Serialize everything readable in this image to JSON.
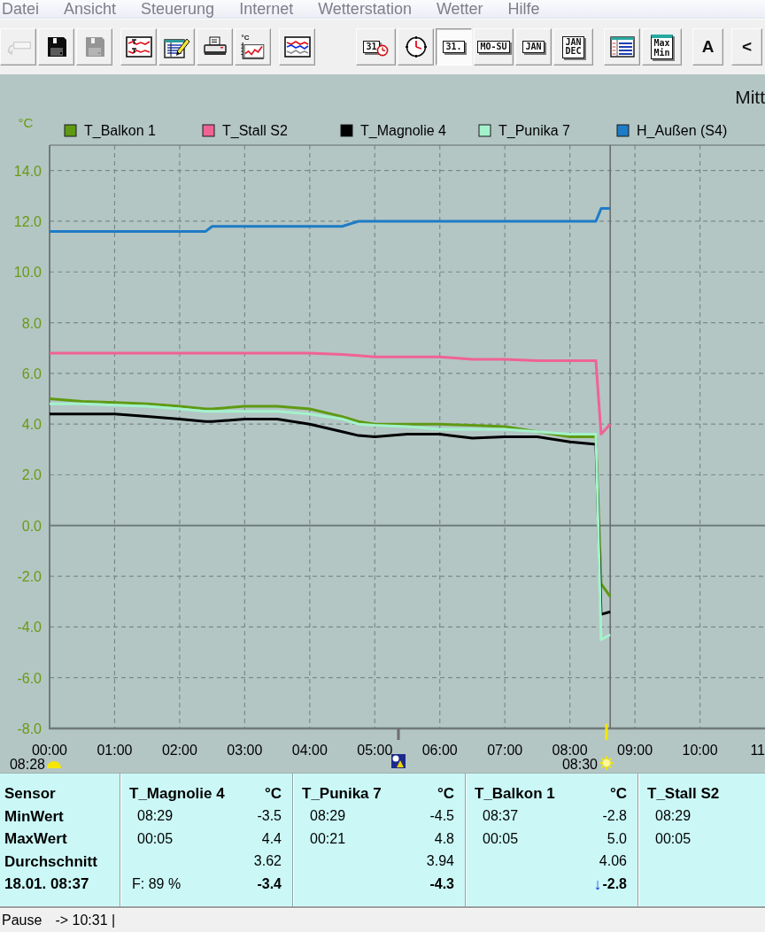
{
  "menu": [
    "Datei",
    "Ansicht",
    "Steuerung",
    "Internet",
    "Wetterstation",
    "Wetter",
    "Hilfe"
  ],
  "toolbar": {
    "groups": [
      {
        "buttons": [
          {
            "kind": "back",
            "disabled": true,
            "selected": false
          },
          {
            "kind": "save",
            "disabled": false,
            "selected": false
          },
          {
            "kind": "save",
            "disabled": true,
            "selected": false
          }
        ]
      },
      {
        "buttons": [
          {
            "kind": "minmax_chart",
            "disabled": false,
            "selected": false
          },
          {
            "kind": "edit_table",
            "disabled": false,
            "selected": false
          },
          {
            "kind": "print",
            "disabled": false,
            "selected": false
          },
          {
            "kind": "temp_chart",
            "label": "°C",
            "disabled": false,
            "selected": false
          }
        ]
      },
      {
        "buttons": [
          {
            "kind": "multi_chart",
            "disabled": false,
            "selected": false
          }
        ]
      },
      {
        "buttons": [
          {
            "kind": "calendar_clock",
            "label": "31",
            "disabled": false,
            "selected": false
          },
          {
            "kind": "clock",
            "disabled": false,
            "selected": false
          },
          {
            "kind": "text_box",
            "label": "31.",
            "disabled": false,
            "selected": true
          },
          {
            "kind": "text_box",
            "label": "MO-SU",
            "disabled": false,
            "selected": false
          },
          {
            "kind": "text_box",
            "label": "JAN",
            "disabled": false,
            "selected": false
          },
          {
            "kind": "text_box",
            "lines": [
              "JAN",
              "DEC"
            ],
            "disabled": false,
            "selected": false
          }
        ]
      },
      {
        "buttons": [
          {
            "kind": "table_view",
            "disabled": false,
            "selected": false
          },
          {
            "kind": "maxmin",
            "lines": [
              "Max",
              "Min"
            ],
            "disabled": false,
            "selected": false
          }
        ]
      },
      {
        "buttons": [
          {
            "kind": "char",
            "label": "A",
            "disabled": false,
            "selected": false
          }
        ]
      },
      {
        "buttons": [
          {
            "kind": "char",
            "label": "<",
            "disabled": false,
            "selected": false
          }
        ]
      }
    ]
  },
  "chart": {
    "markers": [
      {
        "kind": "sunrise",
        "label": "08:28"
      },
      {
        "kind": "moon"
      },
      {
        "kind": "sun",
        "label": "08:30"
      }
    ],
    "chart_data": {
      "type": "line",
      "title": "Mitt",
      "ylabel": "°C",
      "legend": true,
      "grid": true,
      "x": [
        0,
        0.5,
        1,
        1.5,
        2,
        2.4,
        2.5,
        3,
        3.5,
        4,
        4.5,
        4.75,
        5,
        5.5,
        6,
        6.5,
        7,
        7.5,
        8,
        8.4,
        8.48,
        8.62
      ],
      "series": [
        {
          "name": "T_Balkon 1",
          "color": "#5f9a12",
          "values": [
            5.0,
            4.9,
            4.85,
            4.8,
            4.7,
            4.6,
            4.6,
            4.7,
            4.7,
            4.6,
            4.3,
            4.1,
            4.0,
            4.0,
            4.0,
            3.95,
            3.9,
            3.7,
            3.5,
            3.5,
            -2.3,
            -2.8
          ]
        },
        {
          "name": "T_Stall S2",
          "color": "#f06292",
          "values": [
            6.8,
            6.8,
            6.8,
            6.8,
            6.8,
            6.8,
            6.8,
            6.8,
            6.8,
            6.8,
            6.75,
            6.7,
            6.65,
            6.65,
            6.65,
            6.55,
            6.55,
            6.5,
            6.5,
            6.5,
            3.6,
            4.0
          ]
        },
        {
          "name": "T_Magnolie 4",
          "color": "#000000",
          "values": [
            4.4,
            4.4,
            4.4,
            4.3,
            4.2,
            4.1,
            4.1,
            4.2,
            4.2,
            4.0,
            3.7,
            3.55,
            3.5,
            3.6,
            3.6,
            3.45,
            3.5,
            3.5,
            3.3,
            3.2,
            -3.5,
            -3.4
          ]
        },
        {
          "name": "T_Punika 7",
          "color": "#a4f2cc",
          "values": [
            4.8,
            4.8,
            4.75,
            4.7,
            4.6,
            4.5,
            4.5,
            4.5,
            4.5,
            4.4,
            4.2,
            4.0,
            3.95,
            3.9,
            3.8,
            3.8,
            3.8,
            3.7,
            3.6,
            3.6,
            -4.5,
            -4.3
          ]
        },
        {
          "name": "H_Außen (S4)",
          "color": "#1e7bc6",
          "values": [
            11.6,
            11.6,
            11.6,
            11.6,
            11.6,
            11.6,
            11.8,
            11.8,
            11.8,
            11.8,
            11.8,
            12.0,
            12.0,
            12.0,
            12.0,
            12.0,
            12.0,
            12.0,
            12.0,
            12.0,
            12.5,
            12.5
          ]
        }
      ],
      "xlim": [
        0,
        11
      ],
      "ylim": [
        -8,
        15
      ],
      "xticks": [
        {
          "value": 0,
          "label": "00:00"
        },
        {
          "value": 1,
          "label": "01:00"
        },
        {
          "value": 2,
          "label": "02:00"
        },
        {
          "value": 3,
          "label": "03:00"
        },
        {
          "value": 4,
          "label": "04:00"
        },
        {
          "value": 5,
          "label": "05:00"
        },
        {
          "value": 6,
          "label": "06:00"
        },
        {
          "value": 7,
          "label": "07:00"
        },
        {
          "value": 8,
          "label": "08:00"
        },
        {
          "value": 9,
          "label": "09:00"
        },
        {
          "value": 10,
          "label": "10:00"
        },
        {
          "value": 11,
          "label": "11"
        }
      ],
      "yticks": [
        {
          "value": -8,
          "label": "-8.0"
        },
        {
          "value": -6,
          "label": "-6.0"
        },
        {
          "value": -4,
          "label": "-4.0"
        },
        {
          "value": -2,
          "label": "-2.0"
        },
        {
          "value": 0,
          "label": "0.0"
        },
        {
          "value": 2,
          "label": "2.0"
        },
        {
          "value": 4,
          "label": "4.0"
        },
        {
          "value": 6,
          "label": "6.0"
        },
        {
          "value": 8,
          "label": "8.0"
        },
        {
          "value": 10,
          "label": "10.0"
        },
        {
          "value": 12,
          "label": "12.0"
        },
        {
          "value": 14,
          "label": "14.0"
        }
      ],
      "ref_lines": [
        {
          "axis": "x",
          "value": 8.62
        }
      ]
    }
  },
  "stats": {
    "row_labels": [
      "Sensor",
      "MinWert",
      "MaxWert",
      "Durchschnitt",
      "18.01. 08:37"
    ],
    "sensors": [
      {
        "name": "T_Magnolie 4",
        "unit": "°C",
        "min_time": "08:29",
        "min": "-3.5",
        "max_time": "00:05",
        "max": "4.4",
        "average": "3.62",
        "extra": "F: 89 %",
        "current": "-3.4"
      },
      {
        "name": "T_Punika 7",
        "unit": "°C",
        "min_time": "08:29",
        "min": "-4.5",
        "max_time": "00:21",
        "max": "4.8",
        "average": "3.94",
        "current": "-4.3"
      },
      {
        "name": "T_Balkon 1",
        "unit": "°C",
        "min_time": "08:37",
        "min": "-2.8",
        "max_time": "00:05",
        "max": "5.0",
        "average": "4.06",
        "trend_arrow": "↓",
        "current": "-2.8"
      },
      {
        "name": "T_Stall S2",
        "min_time": "08:29",
        "max_time": "00:05"
      }
    ]
  },
  "status_bar": [
    "Pause",
    "-> 10:31 |"
  ]
}
